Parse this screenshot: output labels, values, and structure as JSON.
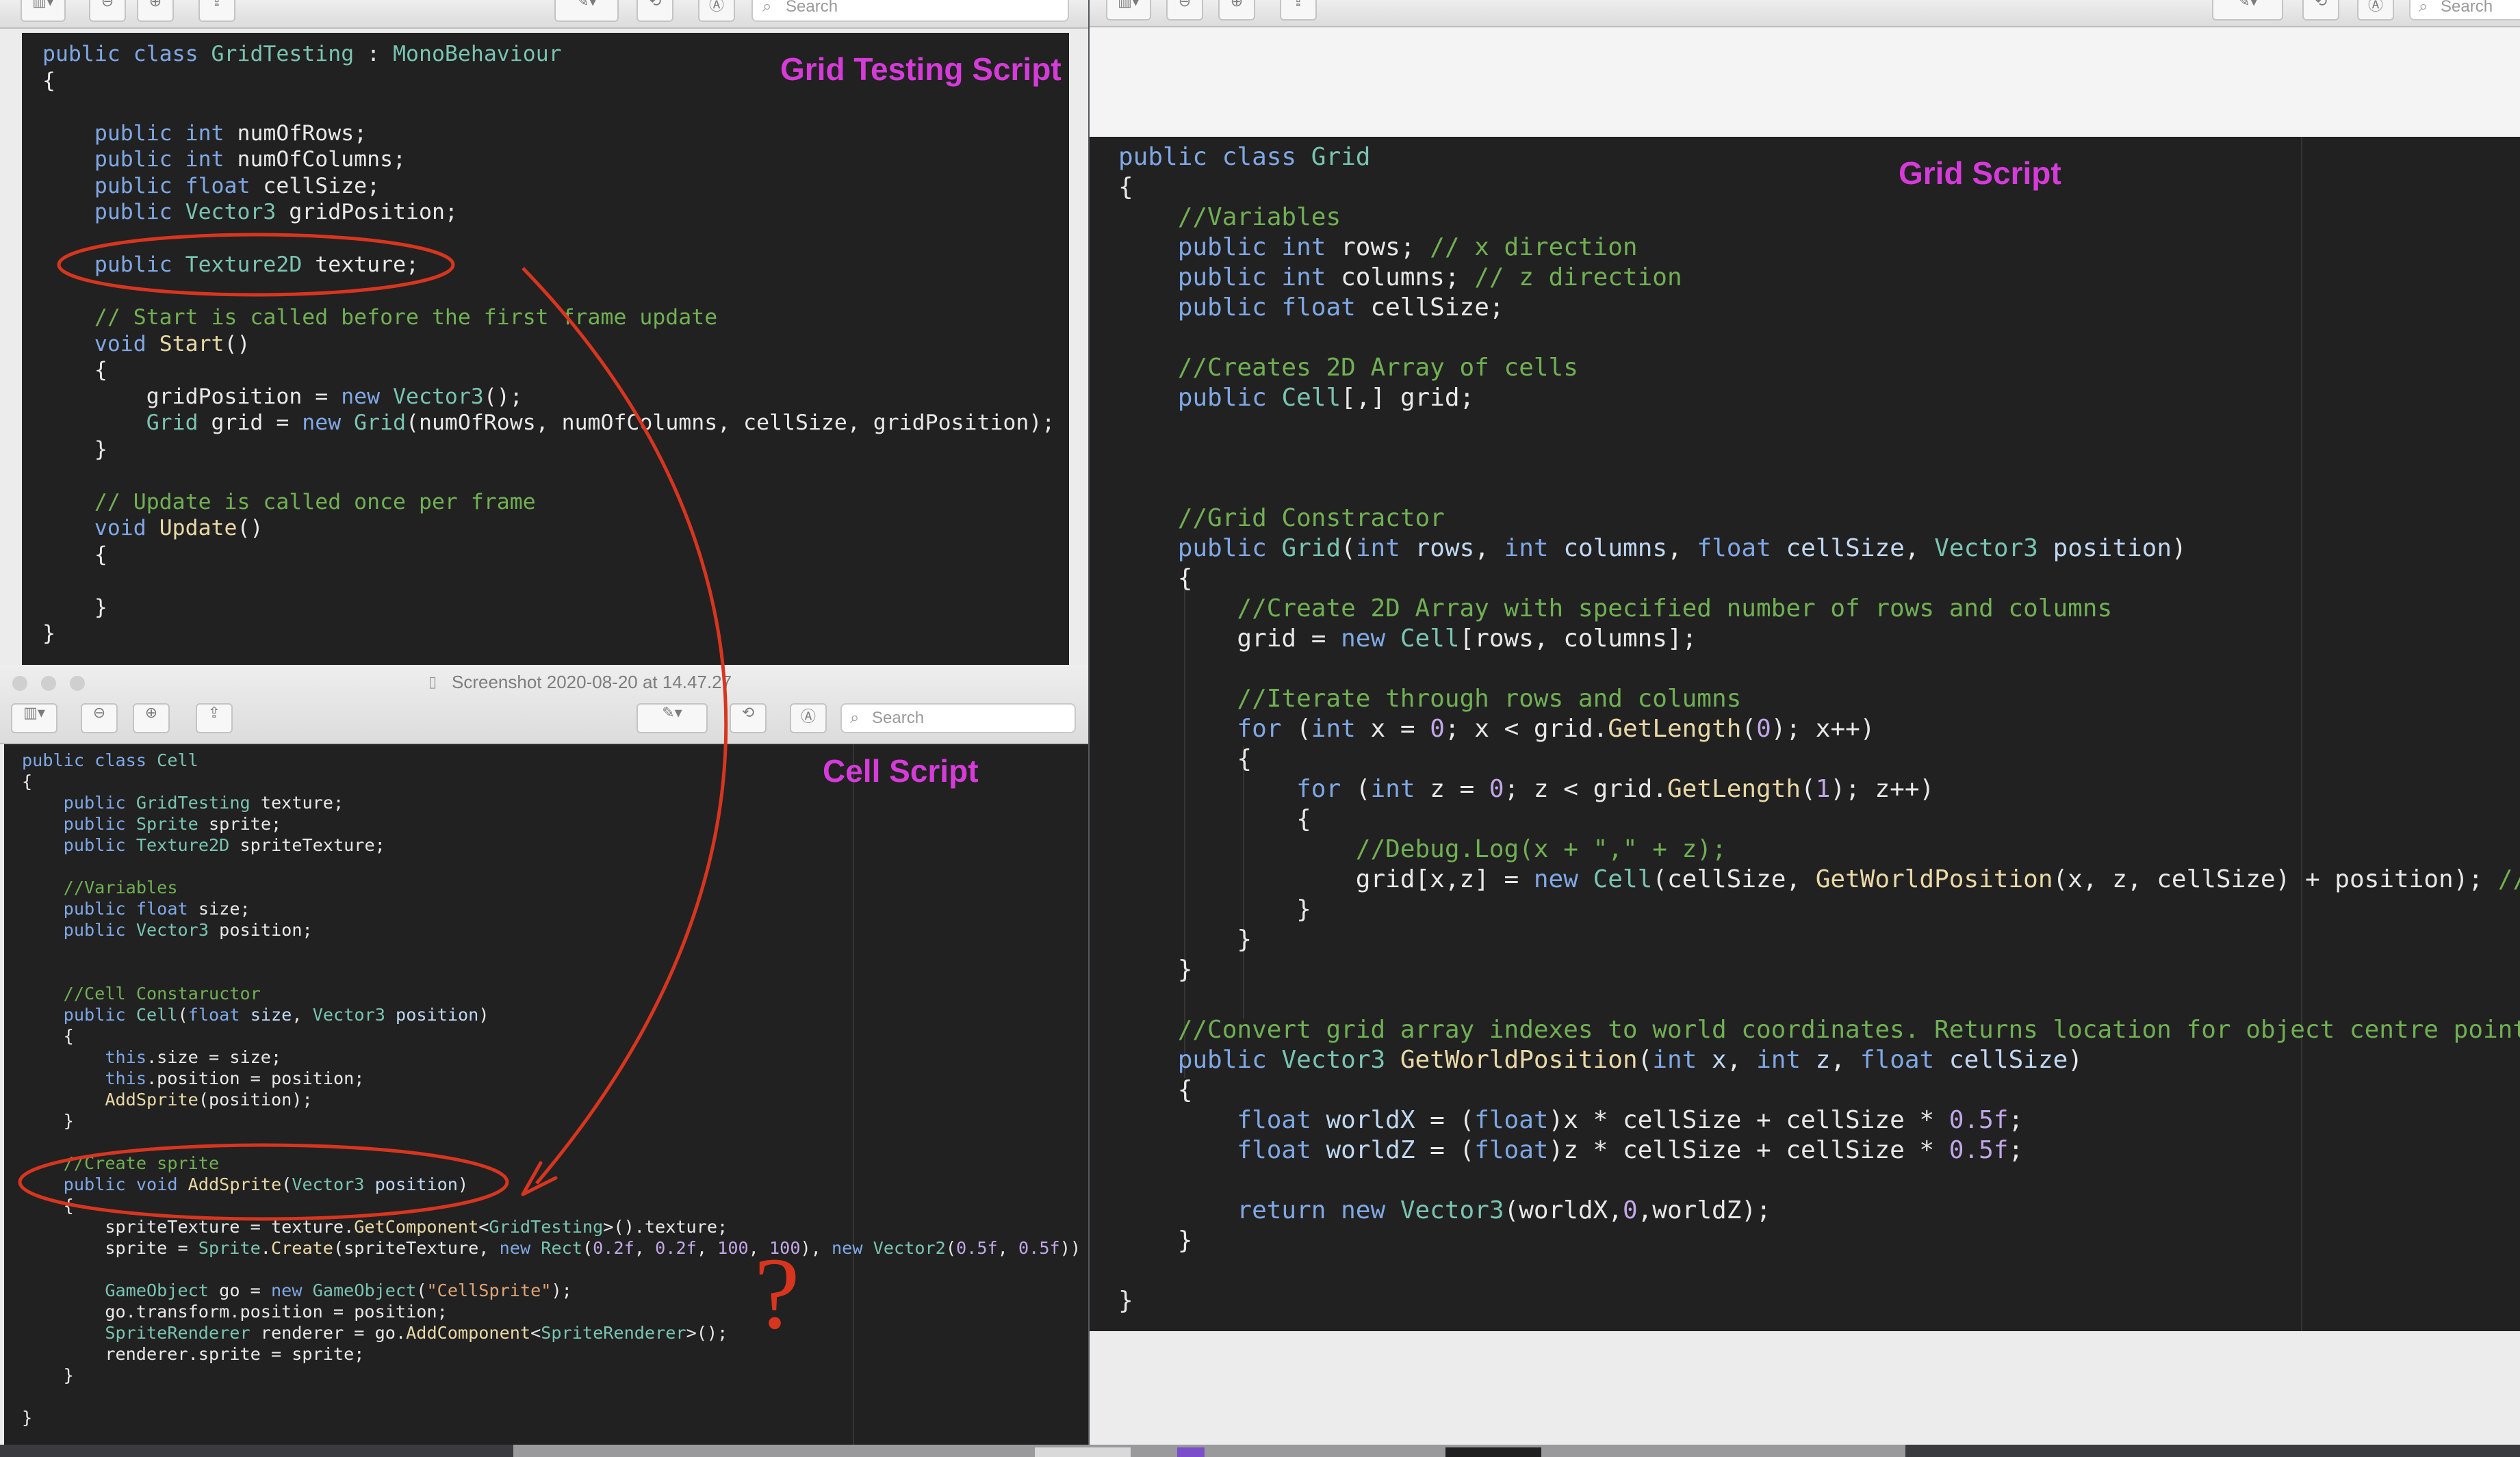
{
  "left_top_window": {
    "search_placeholder": "Search",
    "label": "Grid Testing Script"
  },
  "cell_window": {
    "title": "Screenshot 2020-08-20 at 14.47.27",
    "search_placeholder": "Search",
    "label": "Cell Script",
    "question_mark": "?"
  },
  "right_window": {
    "search_placeholder": "Search",
    "label": "Grid Script"
  },
  "code": {
    "grid_testing": [
      "public class GridTesting : MonoBehaviour",
      "{",
      "",
      "    public int numOfRows;",
      "    public int numOfColumns;",
      "    public float cellSize;",
      "    public Vector3 gridPosition;",
      "",
      "    public Texture2D texture;",
      "",
      "    // Start is called before the first frame update",
      "    void Start()",
      "    {",
      "        gridPosition = new Vector3();",
      "        Grid grid = new Grid(numOfRows, numOfColumns, cellSize, gridPosition);",
      "    }",
      "",
      "    // Update is called once per frame",
      "    void Update()",
      "    {",
      "",
      "    }",
      "}"
    ],
    "cell": [
      "public class Cell",
      "{",
      "    public GridTesting texture;",
      "    public Sprite sprite;",
      "    public Texture2D spriteTexture;",
      "",
      "    //Variables",
      "    public float size;",
      "    public Vector3 position;",
      "",
      "",
      "    //Cell Constaructor",
      "    public Cell(float size, Vector3 position)",
      "    {",
      "        this.size = size;",
      "        this.position = position;",
      "        AddSprite(position);",
      "    }",
      "",
      "    //Create sprite",
      "    public void AddSprite(Vector3 position)",
      "    {",
      "        spriteTexture = texture.GetComponent<GridTesting>().texture;",
      "        sprite = Sprite.Create(spriteTexture, new Rect(0.2f, 0.2f, 100, 100), new Vector2(0.5f, 0.5f))",
      "",
      "        GameObject go = new GameObject(\"CellSprite\");",
      "        go.transform.position = position;",
      "        SpriteRenderer renderer = go.AddComponent<SpriteRenderer>();",
      "        renderer.sprite = sprite;",
      "    }",
      "",
      "}"
    ],
    "grid": [
      "public class Grid",
      "{",
      "    //Variables",
      "    public int rows; // x direction",
      "    public int columns; // z direction",
      "    public float cellSize;",
      "",
      "    //Creates 2D Array of cells",
      "    public Cell[,] grid;",
      "",
      "",
      "",
      "    //Grid Constractor",
      "    public Grid(int rows, int columns, float cellSize, Vector3 position)",
      "    {",
      "        //Create 2D Array with specified number of rows and columns",
      "        grid = new Cell[rows, columns];",
      "",
      "        //Iterate through rows and columns",
      "        for (int x = 0; x < grid.GetLength(0); x++)",
      "        {",
      "            for (int z = 0; z < grid.GetLength(1); z++)",
      "            {",
      "                //Debug.Log(x + \",\" + z);",
      "                grid[x,z] = new Cell(cellSize, GetWorldPosition(x, z, cellSize) + position); //",
      "            }",
      "        }",
      "    }",
      "",
      "    //Convert grid array indexes to world coordinates. Returns location for object centre point",
      "    public Vector3 GetWorldPosition(int x, int z, float cellSize)",
      "    {",
      "        float worldX = (float)x * cellSize + cellSize * 0.5f;",
      "        float worldZ = (float)z * cellSize + cellSize * 0.5f;",
      "",
      "        return new Vector3(worldX,0,worldZ);",
      "    }",
      "",
      "}"
    ]
  },
  "colors": {
    "annotation_red": "#d8351f",
    "label_magenta": "#d63bd9",
    "editor_background": "#212121"
  }
}
